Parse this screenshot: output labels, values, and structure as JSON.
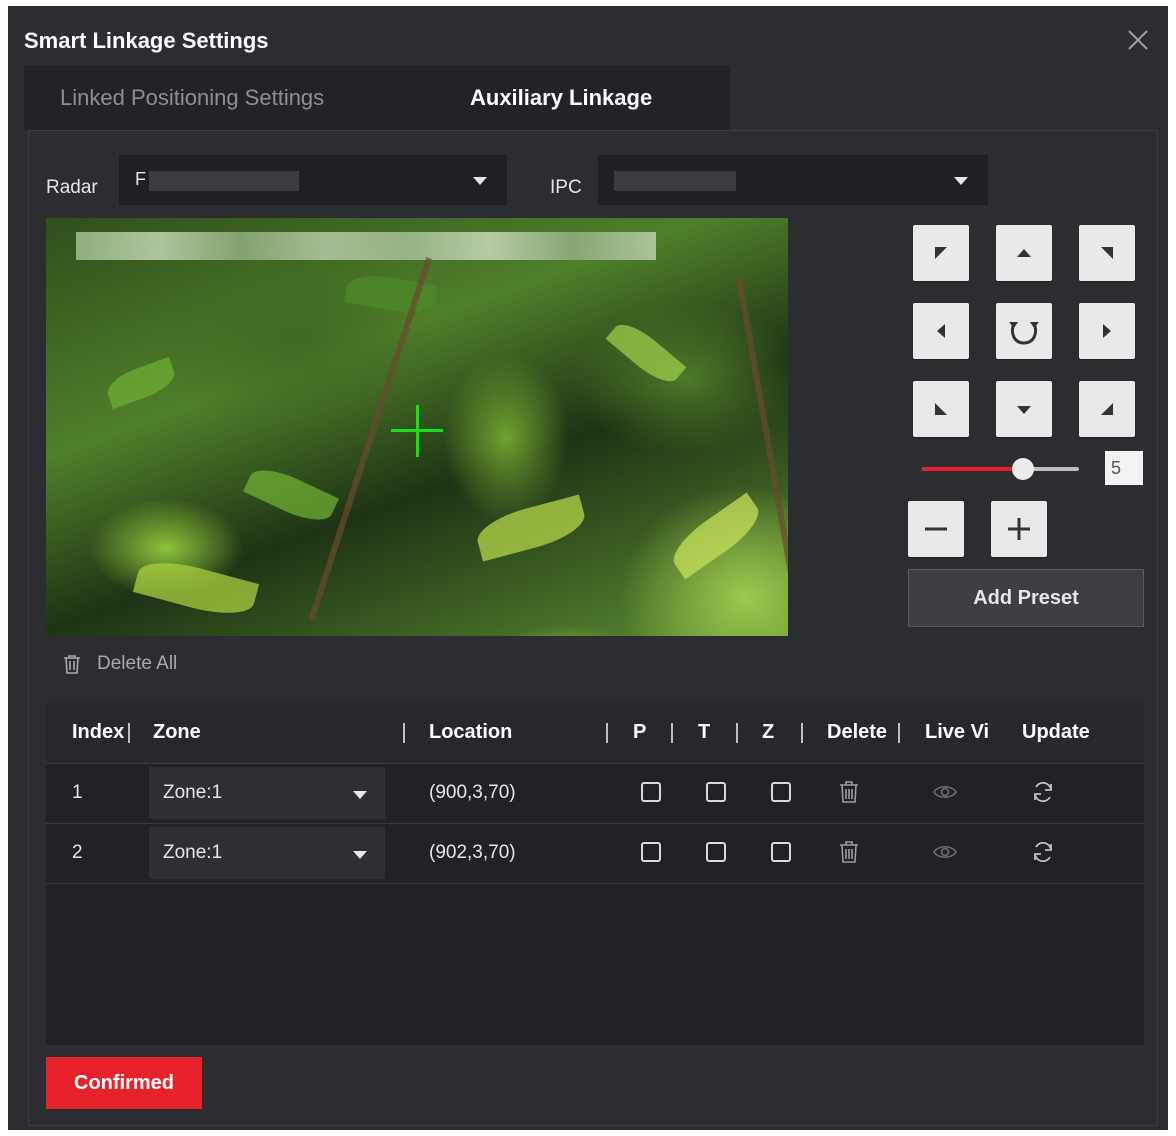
{
  "dialog": {
    "title": "Smart Linkage Settings",
    "close_icon": "close-icon"
  },
  "tabs": [
    {
      "label": "Linked Positioning Settings",
      "active": false
    },
    {
      "label": "Auxiliary Linkage",
      "active": true
    }
  ],
  "radar": {
    "label": "Radar",
    "value": "F"
  },
  "ipc": {
    "label": "IPC",
    "value": ""
  },
  "live_view": {
    "crosshair_icon": "crosshair-icon"
  },
  "delete_all": {
    "label": "Delete All",
    "icon": "trash-icon"
  },
  "ptz": {
    "buttons": [
      "up-left",
      "up",
      "up-right",
      "left",
      "auto-rotate",
      "right",
      "down-left",
      "down",
      "down-right"
    ],
    "speed": {
      "value": "5",
      "min": 1,
      "max": 7
    },
    "zoom_out_icon": "minus-icon",
    "zoom_in_icon": "plus-icon",
    "add_preset_label": "Add Preset"
  },
  "table": {
    "headers": {
      "index": "Index",
      "zone": "Zone",
      "location": "Location",
      "p": "P",
      "t": "T",
      "z": "Z",
      "delete": "Delete",
      "live_view": "Live Vi",
      "update": "Update"
    },
    "rows": [
      {
        "index": "1",
        "zone": "Zone:1",
        "location": "(900,3,70)",
        "p": false,
        "t": false,
        "z": false
      },
      {
        "index": "2",
        "zone": "Zone:1",
        "location": "(902,3,70)",
        "p": false,
        "t": false,
        "z": false
      }
    ]
  },
  "confirm_label": "Confirmed",
  "colors": {
    "accent_red": "#e8222b",
    "background": "#2b2d31",
    "crosshair": "#19e019"
  }
}
